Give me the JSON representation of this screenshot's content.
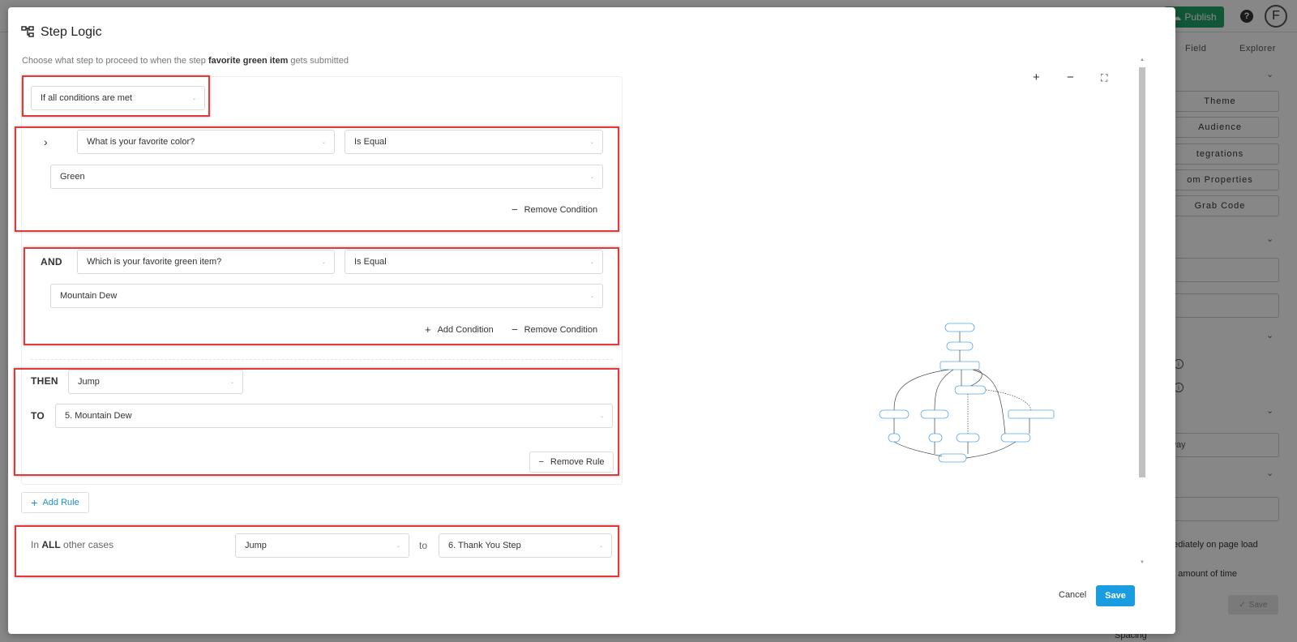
{
  "background": {
    "publish_label": "Publish",
    "help_label": "?",
    "avatar_letter": "F",
    "tabs": [
      "Field",
      "Explorer"
    ],
    "side_buttons": [
      "Theme",
      "Audience",
      "tegrations",
      "om Properties",
      "Grab Code"
    ],
    "side_fields": [
      "way",
      "d"
    ],
    "side_texts": [
      "or",
      "mediately on page load",
      "an amount of time"
    ],
    "save_label": "Save",
    "spacing_label": "Spacing"
  },
  "modal": {
    "title": "Step Logic",
    "subtitle_prefix": "Choose what step to proceed to when the step",
    "subtitle_step": "favorite green item",
    "subtitle_suffix": "gets submitted",
    "match_mode": "If all conditions are met",
    "conditions": [
      {
        "prefix": "",
        "field": "What is your favorite color?",
        "operator": "Is Equal",
        "value": "Green",
        "remove_label": "Remove Condition"
      },
      {
        "prefix": "AND",
        "field": "Which is your favorite green item?",
        "operator": "Is Equal",
        "value": "Mountain Dew",
        "add_label": "Add Condition",
        "remove_label": "Remove Condition"
      }
    ],
    "then_label": "THEN",
    "then_action": "Jump",
    "to_label": "TO",
    "to_target": "5. Mountain Dew",
    "remove_rule_label": "Remove Rule",
    "add_rule_label": "Add Rule",
    "other_cases": {
      "prefix_in": "In",
      "prefix_all": "ALL",
      "prefix_rest": "other cases",
      "action": "Jump",
      "to": "to",
      "target": "6. Thank You Step"
    },
    "footer": {
      "cancel_label": "Cancel",
      "save_label": "Save"
    }
  },
  "colors": {
    "accent_blue": "#1a9ce0",
    "highlight_red": "#e03a3a",
    "publish_green": "#21a366"
  }
}
